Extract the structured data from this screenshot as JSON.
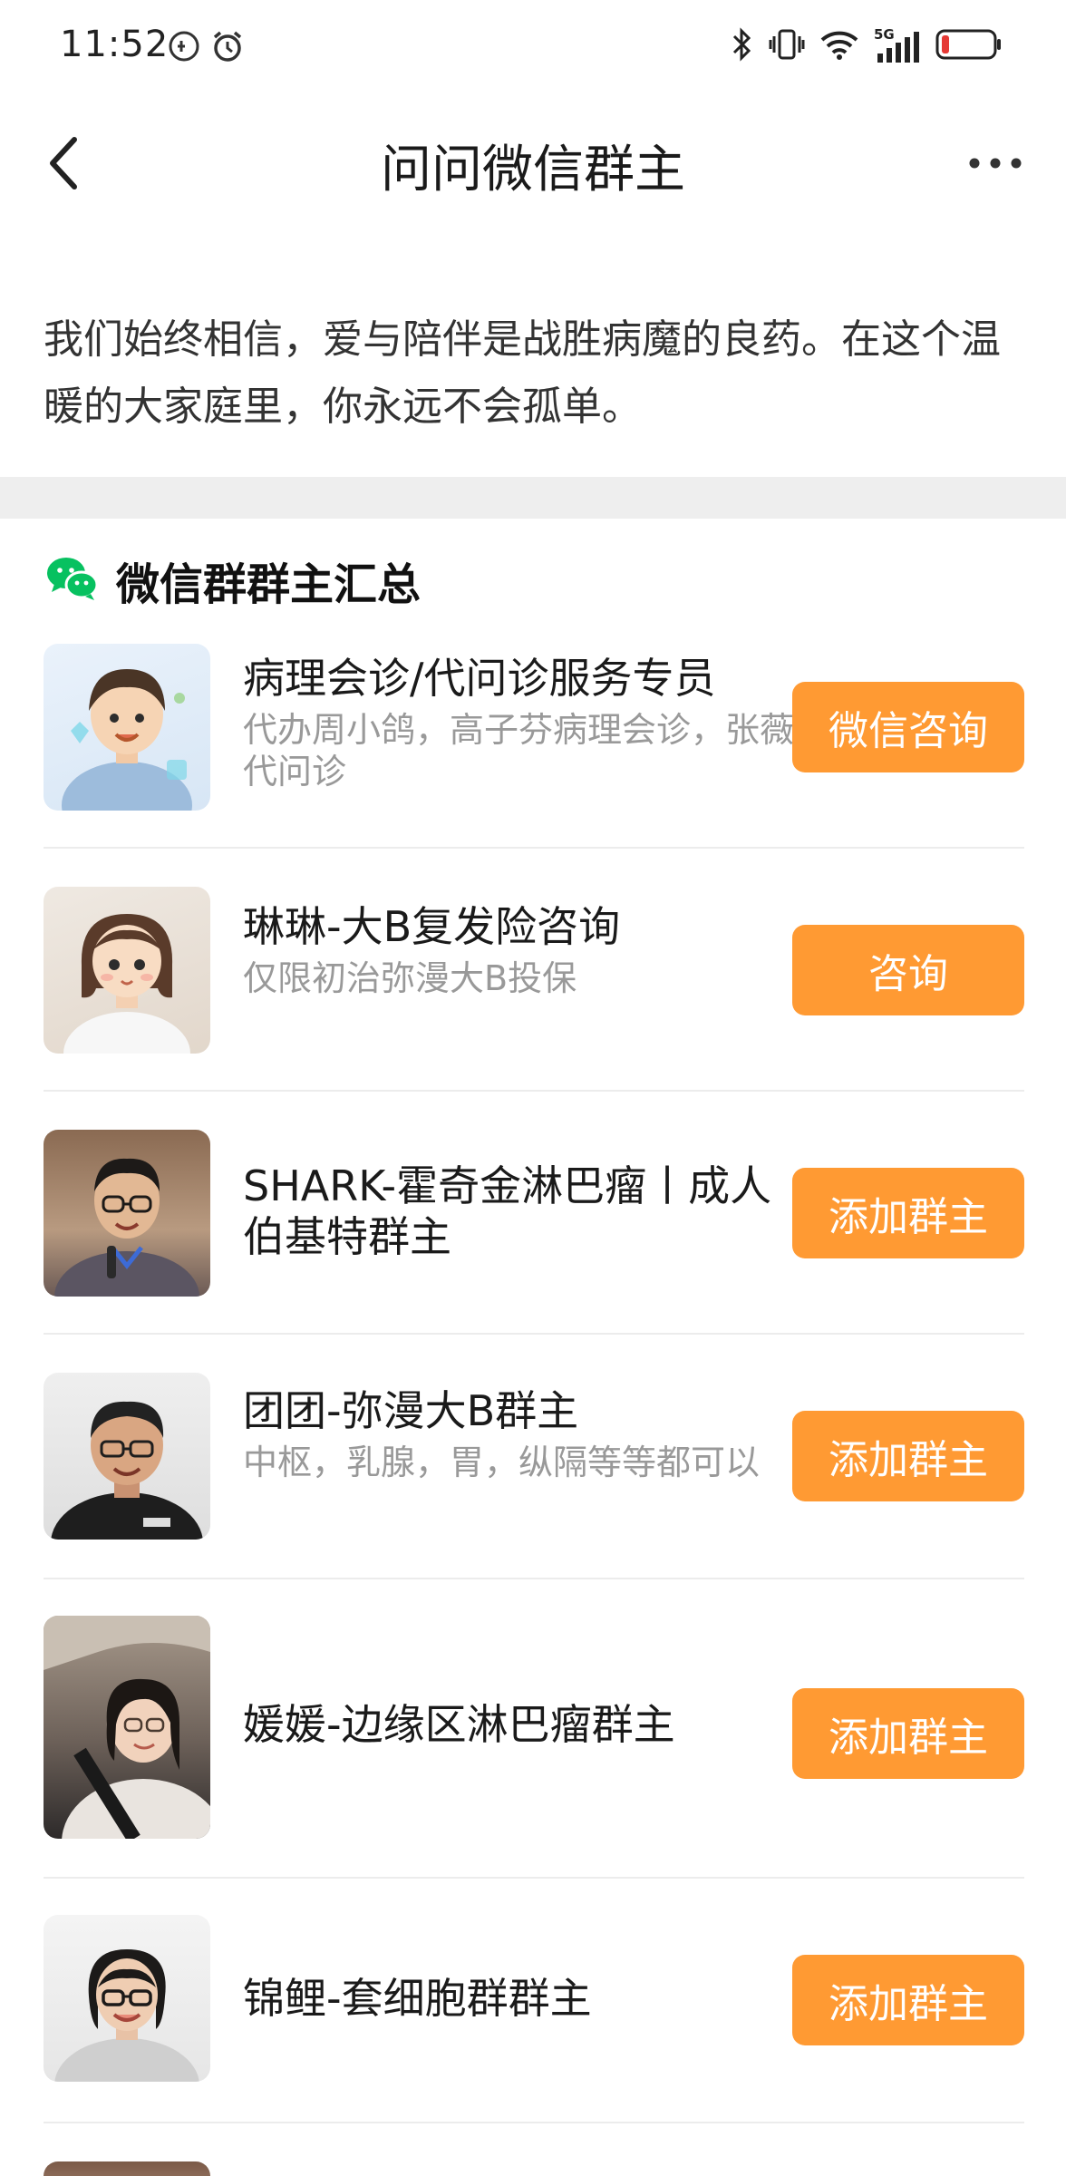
{
  "status_bar": {
    "time": "11:52",
    "left_icons": [
      "notification-icon",
      "alarm-icon"
    ],
    "right_icons": [
      "bluetooth-icon",
      "vibrate-icon",
      "wifi-icon",
      "signal-5g-icon",
      "battery-icon"
    ],
    "network_label": "5G",
    "battery_color": "#e53935"
  },
  "header": {
    "title": "问问微信群主",
    "back_icon": "chevron-left-icon",
    "more_icon": "more-horizontal-icon"
  },
  "intro": {
    "text": "我们始终相信，爱与陪伴是战胜病魔的良药。在这个温暖的大家庭里，你永远不会孤单。"
  },
  "section": {
    "icon": "wechat-icon",
    "icon_color": "#07c160",
    "title": "微信群群主汇总"
  },
  "accent_color": "#ff9a33",
  "items": [
    {
      "title": "病理会诊/代问诊服务专员",
      "desc": "代办周小鸽，高子芬病理会诊，张薇代问诊",
      "button": "微信咨询",
      "avatar": "cartoon-boy-avatar"
    },
    {
      "title": "琳琳-大B复发险咨询",
      "desc": "仅限初治弥漫大B投保",
      "button": "咨询",
      "avatar": "cartoon-girl-avatar"
    },
    {
      "title": "SHARK-霍奇金淋巴瘤丨成人伯基特群主",
      "desc": "",
      "button": "添加群主",
      "avatar": "man-with-glasses-photo"
    },
    {
      "title": "团团-弥漫大B群主",
      "desc": "中枢，乳腺，胃，纵隔等等都可以",
      "button": "添加群主",
      "avatar": "man-black-shirt-photo"
    },
    {
      "title": "媛媛-边缘区淋巴瘤群主",
      "desc": "",
      "button": "添加群主",
      "avatar": "woman-in-car-photo"
    },
    {
      "title": "锦鲤-套细胞群群主",
      "desc": "",
      "button": "添加群主",
      "avatar": "woman-with-glasses-photo"
    }
  ]
}
